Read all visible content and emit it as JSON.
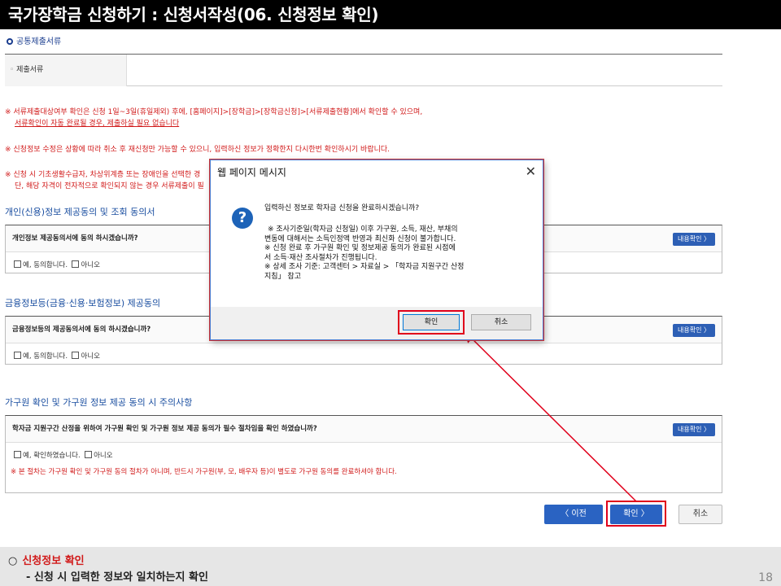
{
  "title": "국가장학금 신청하기 : 신청서작성(06. 신청정보 확인)",
  "common_docs": {
    "heading": "공통제출서류",
    "row_label": "제출서류"
  },
  "notes": {
    "n1_line1": "※ 서류제출대상여부 확인은 신청 1일~3일(휴일제외) 후에, [홈페이지]>[장학금]>[장학금신청]>[서류제출현황]에서 확인할 수 있으며,",
    "n1_line2": "서류확인이 자동 완료될 경우, 제출하실 필요 없습니다",
    "n2": "※ 신청정보 수정은 상황에 따라 취소 후 재신청만 가능할 수 있으니, 입력하신 정보가 정확한지 다시한번 확인하시기 바랍니다.",
    "n3_line1": "※ 신청 시 기초생활수급자, 차상위계층 또는 장애인을 선택한 경",
    "n3_line2": "단, 해당 자격이 전자적으로 확인되지 않는 경우 서류제출이 필"
  },
  "section1": {
    "heading": "개인(신용)정보 제공동의 및 조회 동의서",
    "question": "개인정보 제공동의서에 동의 하시겠습니까?",
    "detail": "내용확인 〉",
    "yes": "예, 동의합니다.",
    "no": "아니오"
  },
  "section2": {
    "heading": "금융정보등(금융·신용·보험정보) 제공동의",
    "question": "금융정보등의 제공동의서에 동의 하시겠습니까?",
    "detail": "내용확인 〉",
    "yes": "예, 동의합니다.",
    "no": "아니오"
  },
  "section3": {
    "heading": "가구원 확인 및 가구원 정보 제공 동의 시 주의사항",
    "question": "학자금 지원구간 산정을 위하여 가구원 확인 및 가구원 정보 제공 동의가 필수 절차임을 확인 하였습니까?",
    "detail": "내용확인 〉",
    "yes": "예, 확인하였습니다.",
    "no": "아니오",
    "note": "※ 본 절차는 가구원 확인 및 가구원 동의 절차가 아니며, 반드시 가구원(부, 모, 배우자 등)이 별도로 가구원 동의를 완료하셔야 합니다."
  },
  "buttons": {
    "prev": "〈  이전",
    "ok": "확인  〉",
    "cancel": "취소"
  },
  "dialog": {
    "title": "웹 페이지 메시지",
    "close": "✕",
    "icon": "?",
    "question": "입력하신 정보로 학자금 신청을 완료하시겠습니까?",
    "line1": "※ 조사기준일(학자금 신청일) 이후 가구원, 소득, 재산, 부채의",
    "line2": "변동에 대해서는 소득인정액 반영과 최신화 신청이 불가합니다.",
    "line3": "※ 신청 완료 후 가구원 확인 및 정보제공 동의가 완료된 시점에",
    "line4": "서 소득·재산 조사절차가 진행됩니다.",
    "line5": "※ 상세 조사 기준: 고객센터 > 자료실 > 「학자금 지원구간 산정",
    "line6": "지침」 참고",
    "ok": "확인",
    "cancel": "취소"
  },
  "footer": {
    "circle": "○",
    "line1": "신청정보 확인",
    "line2": "- 신청 시 입력한 정보와 일치하는지 확인",
    "page": "18"
  },
  "colors": {
    "accent_red": "#e0001b",
    "button_blue": "#2a63c2"
  }
}
